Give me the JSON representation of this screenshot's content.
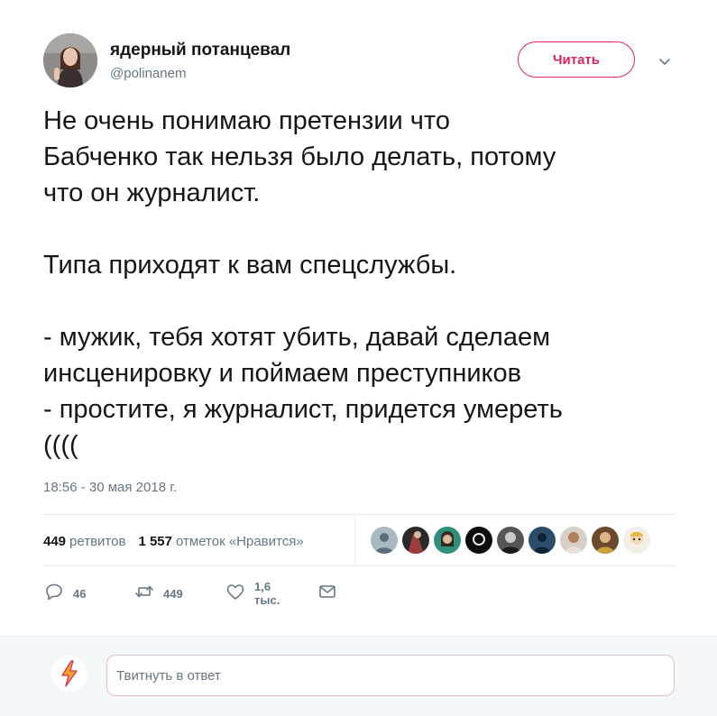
{
  "author": {
    "name": "ядерный потанцевал",
    "handle": "@polinanem"
  },
  "follow_button": {
    "label": "Читать"
  },
  "tweet": {
    "lines": [
      "Не очень понимаю претензии что",
      "Бабченко так нельзя было делать, потому",
      "что он журналист.",
      "",
      "Типа приходят к вам спецслужбы.",
      "",
      "- мужик, тебя хотят убить, давай сделаем",
      "инсценировку и поймаем преступников",
      "- простите, я журналист, придется умереть",
      "(((("
    ],
    "timestamp": "18:56 - 30 мая 2018 г."
  },
  "stats": {
    "retweets_count": "449",
    "retweets_label": "ретвитов",
    "likes_count": "1 557",
    "likes_label": "отметок «Нравится»"
  },
  "actions": {
    "replies": "46",
    "retweets": "449",
    "likes": "1,6 тыс."
  },
  "reply": {
    "placeholder": "Твитнуть в ответ"
  },
  "colors": {
    "accent": "#e0245e",
    "text": "#14171a",
    "muted": "#657786",
    "divider": "#e6ecf0",
    "reply_bg": "#f5f8fa"
  }
}
